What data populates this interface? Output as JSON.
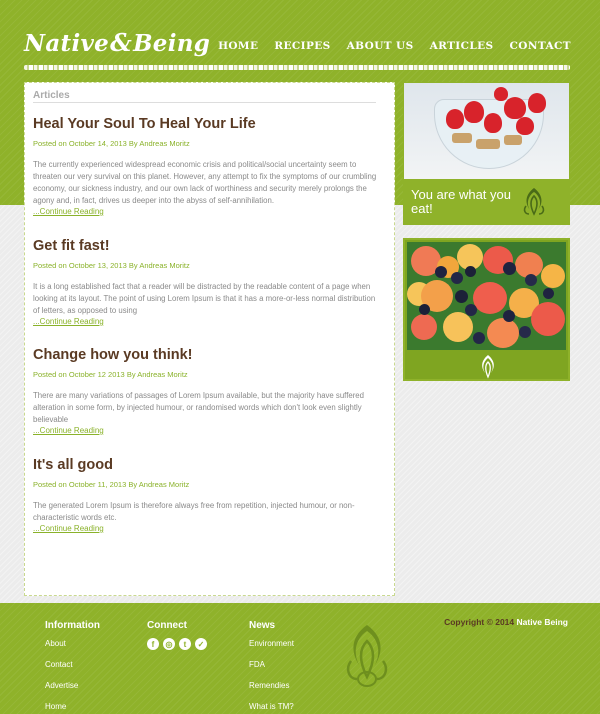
{
  "brand": {
    "name_first": "Native",
    "name_second": "Being"
  },
  "nav": [
    {
      "label": "HOME"
    },
    {
      "label": "RECIPES"
    },
    {
      "label": "ABOUT US"
    },
    {
      "label": "ARTICLES"
    },
    {
      "label": "CONTACT"
    }
  ],
  "main": {
    "section_title": "Articles",
    "articles": [
      {
        "title": "Heal Your Soul To Heal Your Life",
        "meta": "Posted on October 14, 2013 By Andreas Moritz",
        "excerpt": "The currently experienced widespread economic crisis and political/social uncertainty seem to threaten our very survival on this planet. However, any attempt to fix the symptoms of our crumbling economy, our sickness industry, and our own lack of worthiness and security merely prolongs the agony and, in fact, drives us deeper into the abyss of self-annihilation.",
        "more": "...Continue Reading"
      },
      {
        "title": "Get fit fast!",
        "meta": "Posted on October 13, 2013 By Andreas Moritz",
        "excerpt": "It is a long established fact that a reader will be distracted by the readable content of a page when looking at its layout. The point of using Lorem Ipsum is that it has a more-or-less normal distribution of letters, as opposed to using",
        "more": "...Continue Reading"
      },
      {
        "title": "Change how you think!",
        "meta": "Posted on October 12 2013 By Andreas Moritz",
        "excerpt": "There are many variations of passages of Lorem Ipsum available, but the majority have suffered alteration in some form, by injected humour, or randomised words which don't look even slightly believable",
        "more": "...Continue Reading"
      },
      {
        "title": "It's all good",
        "meta": "Posted on October 11, 2013 By Andreas Moritz",
        "excerpt": "The generated Lorem Ipsum is therefore always free from repetition, injected humour, or non-characteristic words etc.",
        "more": "...Continue Reading"
      }
    ]
  },
  "sidebar": {
    "promo_text": "You are what you eat!"
  },
  "footer": {
    "information": {
      "title": "Information",
      "links": [
        "About",
        "Contact",
        "Advertise",
        "Home"
      ]
    },
    "connect": {
      "title": "Connect",
      "icons": [
        "facebook-icon",
        "instagram-icon",
        "tumblr-icon",
        "twitter-icon"
      ]
    },
    "news": {
      "title": "News",
      "links": [
        "Environment",
        "FDA",
        "Remendies",
        "What is TM?"
      ]
    },
    "copyright_prefix": "Copyright © 2014",
    "copyright_brand": "Native Being"
  },
  "colors": {
    "accent": "#8fb22a",
    "title_brown": "#5a3a23",
    "link_green": "#8ab22a"
  }
}
